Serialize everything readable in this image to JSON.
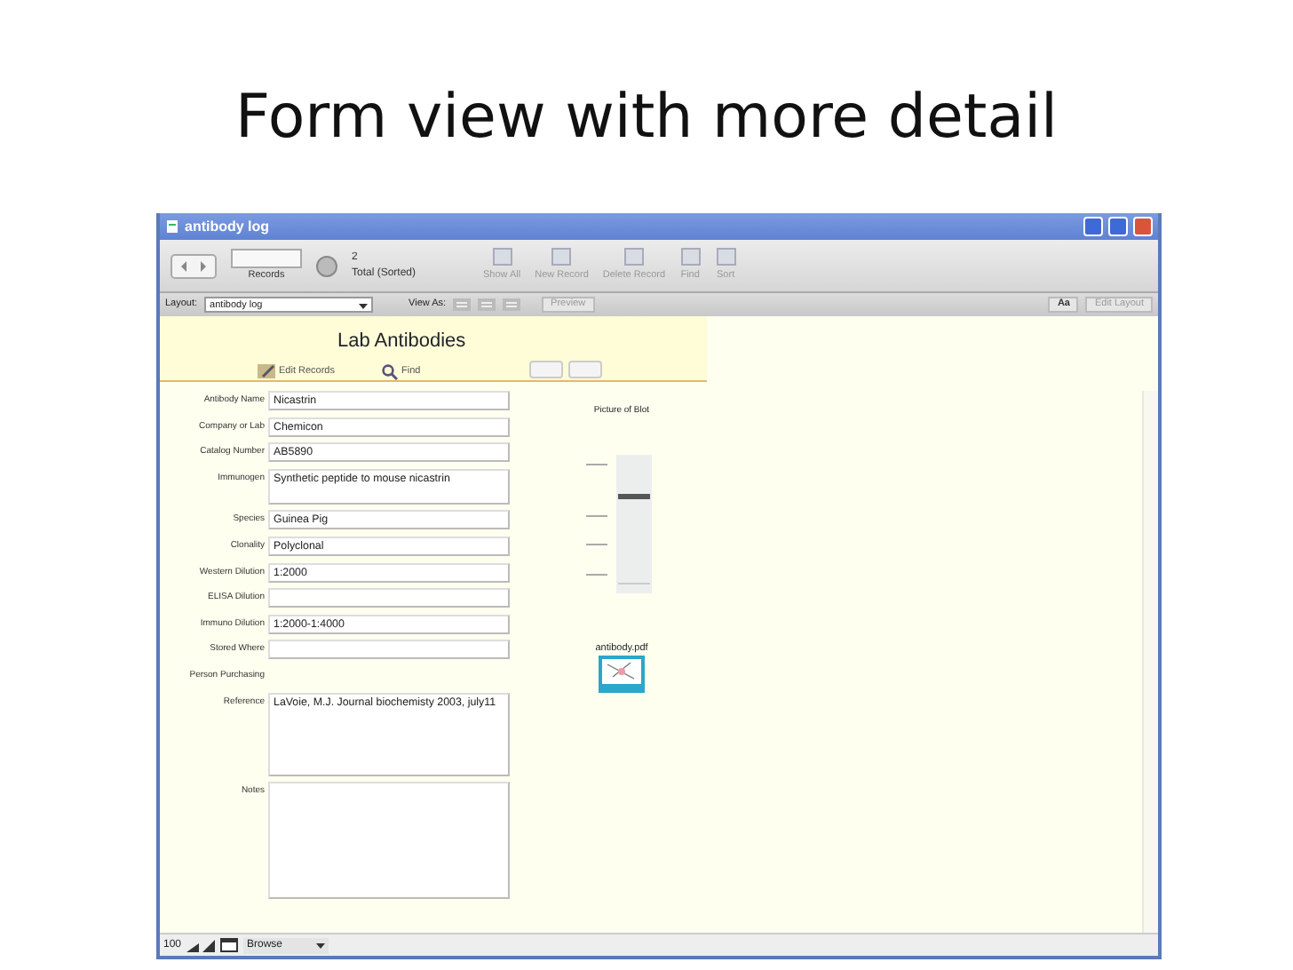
{
  "slide": {
    "title": "Form view with more detail"
  },
  "window": {
    "title": "antibody log"
  },
  "toolbar": {
    "records_label": "Records",
    "count": "2",
    "total_label": "Total (Sorted)",
    "buttons": [
      {
        "label": "Show All",
        "disabled": true
      },
      {
        "label": "New Record",
        "disabled": true
      },
      {
        "label": "Delete Record",
        "disabled": true
      },
      {
        "label": "Find",
        "disabled": true
      },
      {
        "label": "Sort",
        "disabled": true
      }
    ]
  },
  "layout_bar": {
    "layout_label": "Layout:",
    "layout": "antibody log",
    "view_as_label": "View As:",
    "preview": "Preview",
    "font_button": "Aa",
    "edit_layout": "Edit Layout"
  },
  "header": {
    "title": "Lab Antibodies",
    "edit_records": "Edit Records",
    "find": "Find"
  },
  "fields": [
    {
      "label": "Antibody Name",
      "value": "Nicastrin",
      "kind": "line"
    },
    {
      "label": "Company or Lab",
      "value": "Chemicon",
      "kind": "line"
    },
    {
      "label": "Catalog Number",
      "value": "AB5890",
      "kind": "line"
    },
    {
      "label": "Immunogen",
      "value": "Synthetic peptide to mouse nicastrin",
      "kind": "double"
    },
    {
      "label": "Species",
      "value": "Guinea Pig",
      "kind": "line"
    },
    {
      "label": "Clonality",
      "value": "Polyclonal",
      "kind": "line"
    },
    {
      "label": "Western Dilution",
      "value": "1:2000",
      "kind": "line"
    },
    {
      "label": "ELISA Dilution",
      "kind": "line"
    },
    {
      "label": "Immuno Dilution",
      "value": "1:2000-1:4000",
      "kind": "line"
    },
    {
      "label": "Stored Where",
      "kind": "line"
    },
    {
      "label": "Person Purchasing",
      "kind": "bare"
    },
    {
      "label": "Reference",
      "value": "LaVoie, M.J. Journal biochemisty 2003, july11",
      "kind": "area"
    },
    {
      "label": "Notes",
      "kind": "large"
    }
  ],
  "picture": {
    "label": "Picture of Blot",
    "kind": "picture"
  },
  "attachment": {
    "label": "antibody.pdf"
  },
  "status_bar": {
    "zoom": "100",
    "mode": "Browse"
  }
}
